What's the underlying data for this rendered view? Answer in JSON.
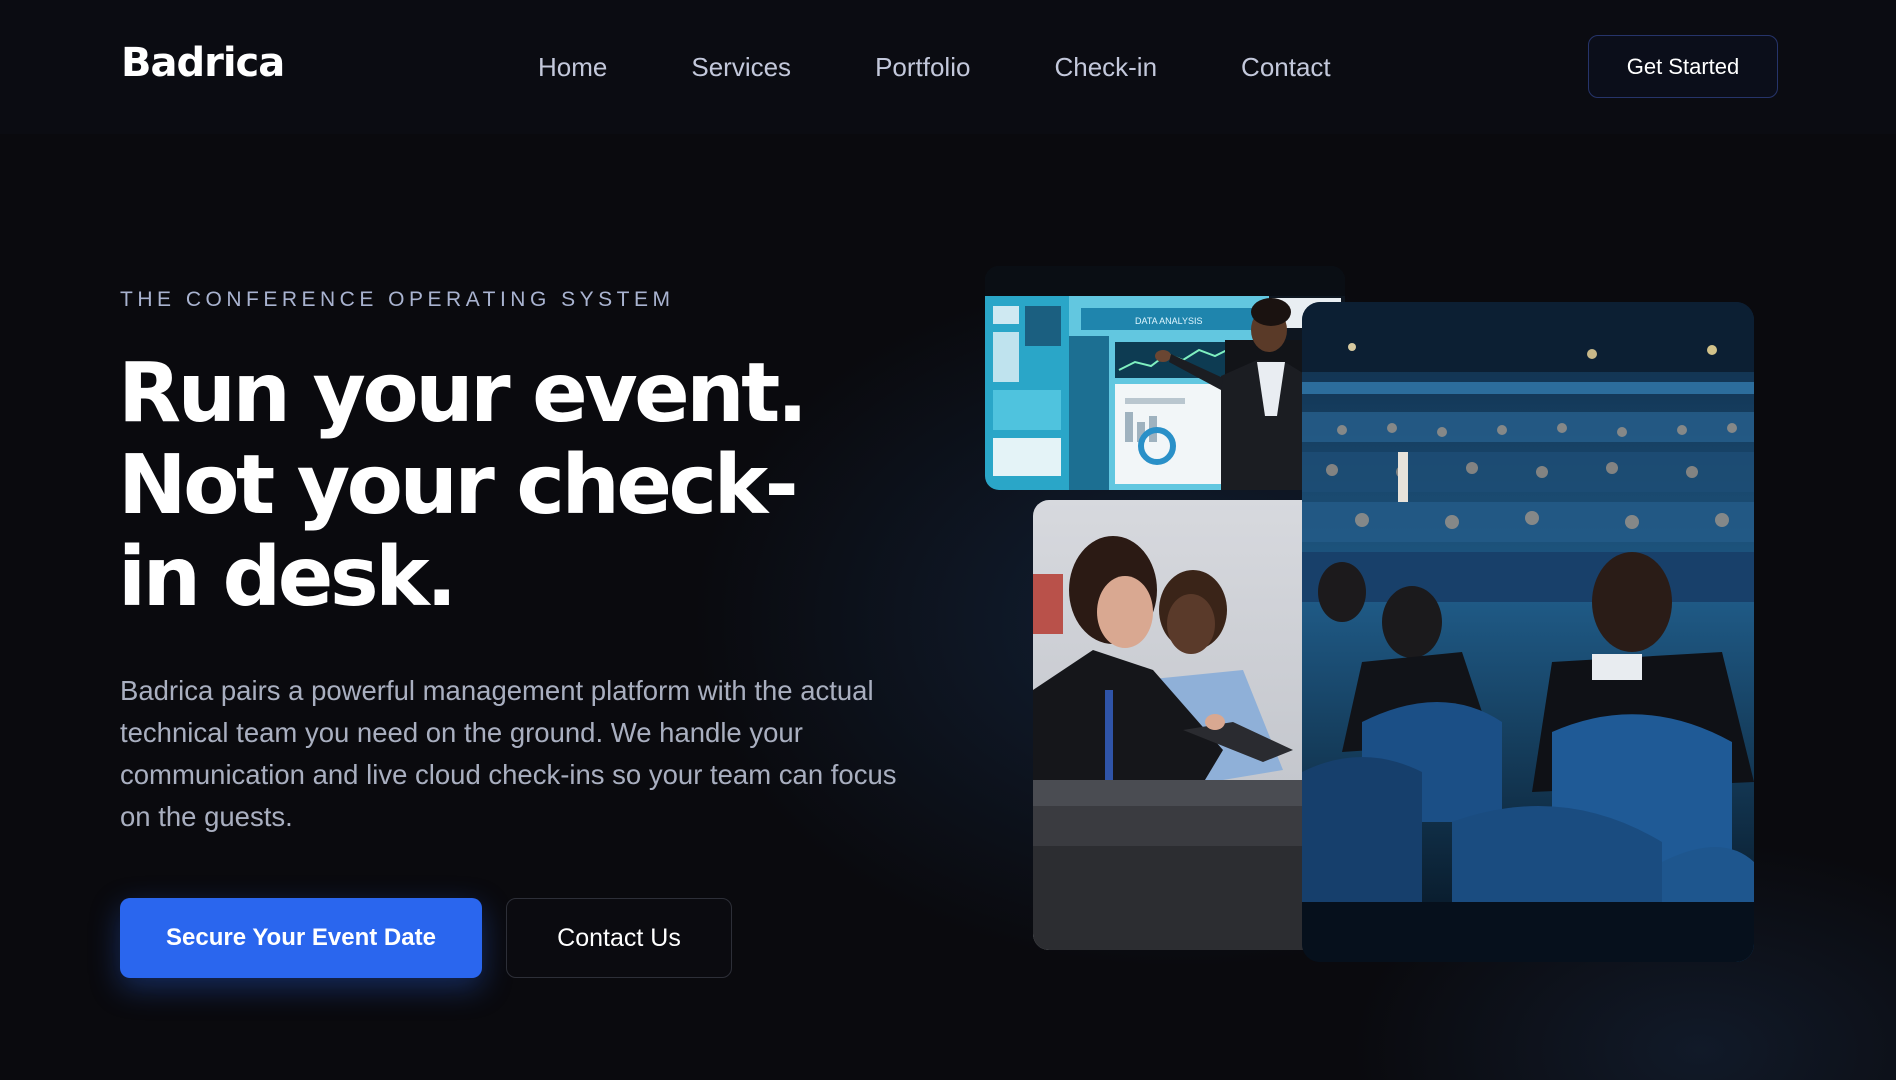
{
  "nav": {
    "logo": "Badrica",
    "links": [
      "Home",
      "Services",
      "Portfolio",
      "Check-in",
      "Contact"
    ],
    "cta_label": "Get Started"
  },
  "hero": {
    "eyebrow": "THE CONFERENCE OPERATING SYSTEM",
    "headline_lines": [
      "Run your event.",
      "Not your check-",
      "in desk."
    ],
    "description": "Badrica pairs a powerful management platform with the actual technical team you need on the ground. We handle your communication and live cloud check-ins so your team can focus on the guests.",
    "primary_button": "Secure Your Event Date",
    "secondary_button": "Contact Us"
  },
  "images": {
    "speaker_screen_text": "DATA ANALYSIS"
  },
  "colors": {
    "background": "#0a0a0e",
    "accent": "#2a66ee",
    "nav_text": "#c3c8db",
    "eyebrow": "#a9b3d0",
    "body_text": "#a9afc0"
  }
}
